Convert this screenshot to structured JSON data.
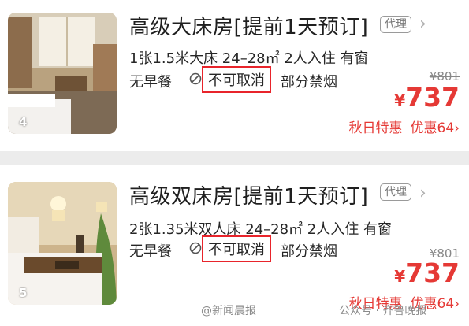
{
  "rooms": [
    {
      "title": "高级大床房[提前1天预订]",
      "badge": "代理",
      "chevron": "›",
      "info": "1张1.5米大床  24–28㎡  2人入住  有窗",
      "breakfast": "无早餐",
      "cancel_policy": "不可取消",
      "smoking": "部分禁烟",
      "original_price": "¥801",
      "currency": "¥",
      "price": "737",
      "promo_label": "秋日特惠",
      "discount": "优惠64",
      "discount_arrow": "›",
      "photo_count": "4"
    },
    {
      "title": "高级双床房[提前1天预订]",
      "badge": "代理",
      "chevron": "›",
      "info": "2张1.35米双人床  24–28㎡  2人入住  有窗",
      "breakfast": "无早餐",
      "cancel_policy": "不可取消",
      "smoking": "部分禁烟",
      "original_price": "¥801",
      "currency": "¥",
      "price": "737",
      "promo_label": "秋日特惠",
      "discount": "优惠64",
      "discount_arrow": "›",
      "photo_count": "5"
    }
  ],
  "watermark": {
    "left": "@新闻晨报",
    "right": "公众号 · 齐鲁晚报"
  },
  "colors": {
    "price_red": "#e53935",
    "highlight_box": "#e8242b"
  }
}
